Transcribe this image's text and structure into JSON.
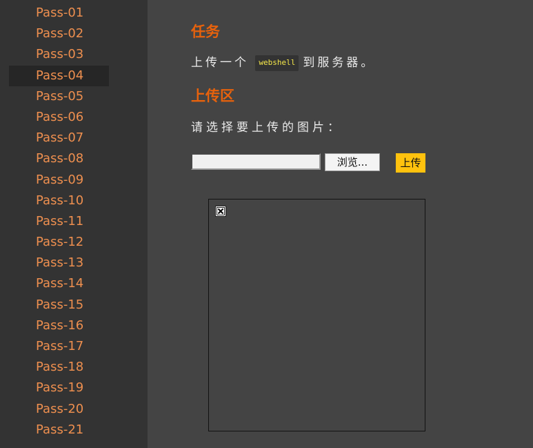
{
  "sidebar": {
    "items": [
      {
        "label": "Pass-01"
      },
      {
        "label": "Pass-02"
      },
      {
        "label": "Pass-03"
      },
      {
        "label": "Pass-04",
        "active": true
      },
      {
        "label": "Pass-05"
      },
      {
        "label": "Pass-06"
      },
      {
        "label": "Pass-07"
      },
      {
        "label": "Pass-08"
      },
      {
        "label": "Pass-09"
      },
      {
        "label": "Pass-10"
      },
      {
        "label": "Pass-11"
      },
      {
        "label": "Pass-12"
      },
      {
        "label": "Pass-13"
      },
      {
        "label": "Pass-14"
      },
      {
        "label": "Pass-15"
      },
      {
        "label": "Pass-16"
      },
      {
        "label": "Pass-17"
      },
      {
        "label": "Pass-18"
      },
      {
        "label": "Pass-19"
      },
      {
        "label": "Pass-20"
      },
      {
        "label": "Pass-21"
      }
    ]
  },
  "task": {
    "title": "任务",
    "text_before": "上传一个",
    "code": "webshell",
    "text_after": "到服务器。"
  },
  "upload": {
    "title": "上传区",
    "prompt": "请选择要上传的图片：",
    "file_value": "",
    "browse_label": "浏览...",
    "submit_label": "上传"
  },
  "preview": {
    "image_icon": "broken-image-icon"
  },
  "colors": {
    "accent": "#e8620c",
    "link": "#ee8f4f",
    "submit": "#ffc20e",
    "code_text": "#f6e84a",
    "sidebar_bg": "#333333",
    "main_bg": "#444444"
  }
}
